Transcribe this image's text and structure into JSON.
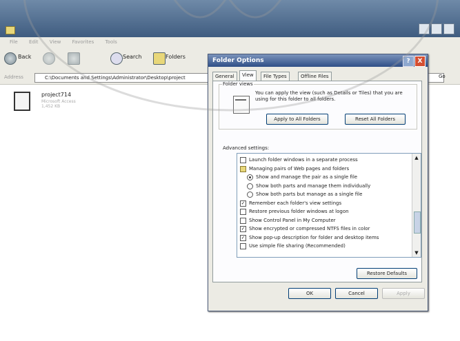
{
  "explorer": {
    "title": "",
    "menu": [
      "File",
      "Edit",
      "View",
      "Favorites",
      "Tools"
    ],
    "toolbar": {
      "back": "Back",
      "search": "Search",
      "folders": "Folders"
    },
    "address": {
      "label": "Address",
      "value": "C:\\Documents and Settings\\Administrator\\Desktop\\project",
      "go": "Go"
    },
    "file": {
      "name": "project714",
      "type": "Microsoft Access",
      "size": "1,452 KB"
    }
  },
  "dialog": {
    "title": "Folder Options",
    "help": "?",
    "close": "X",
    "tabs": [
      "General",
      "View",
      "File Types",
      "Offline Files"
    ],
    "folder_views": {
      "legend": "Folder views",
      "text": "You can apply the view (such as Details or Tiles) that you are using for this folder to all folders.",
      "apply": "Apply to All Folders",
      "reset": "Reset All Folders"
    },
    "advanced_label": "Advanced settings:",
    "advanced_items": [
      {
        "kind": "check",
        "checked": false,
        "indent": 0,
        "label": "Launch folder windows in a separate process"
      },
      {
        "kind": "folder",
        "indent": 0,
        "label": "Managing pairs of Web pages and folders"
      },
      {
        "kind": "radio",
        "checked": true,
        "indent": 1,
        "label": "Show and manage the pair as a single file"
      },
      {
        "kind": "radio",
        "checked": false,
        "indent": 1,
        "label": "Show both parts and manage them individually"
      },
      {
        "kind": "radio",
        "checked": false,
        "indent": 1,
        "label": "Show both parts but manage as a single file"
      },
      {
        "kind": "check",
        "checked": true,
        "indent": 0,
        "label": "Remember each folder's view settings"
      },
      {
        "kind": "check",
        "checked": false,
        "indent": 0,
        "label": "Restore previous folder windows at logon"
      },
      {
        "kind": "check",
        "checked": false,
        "indent": 0,
        "label": "Show Control Panel in My Computer"
      },
      {
        "kind": "check",
        "checked": true,
        "indent": 0,
        "label": "Show encrypted or compressed NTFS files in color"
      },
      {
        "kind": "check",
        "checked": true,
        "indent": 0,
        "label": "Show pop-up description for folder and desktop items"
      },
      {
        "kind": "check",
        "checked": false,
        "indent": 0,
        "label": "Use simple file sharing (Recommended)"
      }
    ],
    "restore_defaults": "Restore Defaults",
    "ok": "OK",
    "cancel": "Cancel",
    "apply": "Apply"
  }
}
